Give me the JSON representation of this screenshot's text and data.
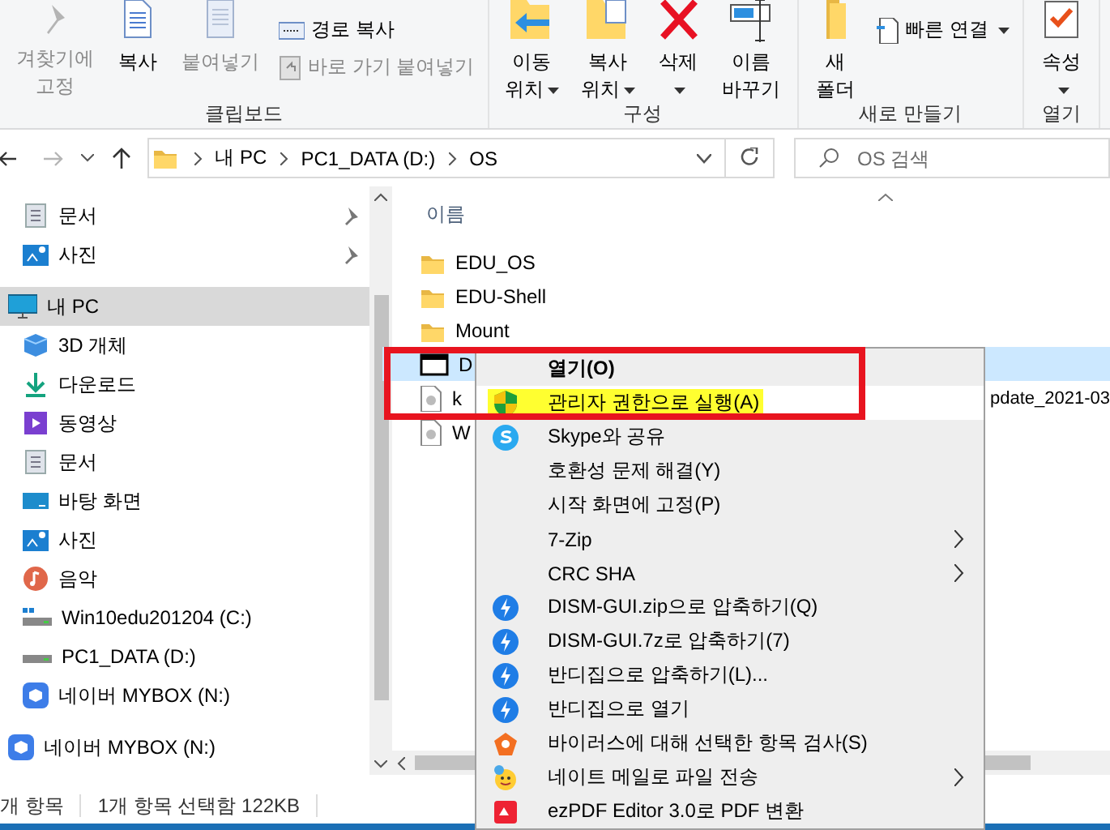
{
  "ribbon": {
    "groups": [
      {
        "label": "클립보드",
        "items": [
          {
            "kind": "large",
            "lines": [
              "겨찾기에",
              "고정"
            ],
            "dropdown": false,
            "disabled": true
          },
          {
            "kind": "large",
            "lines": [
              "복사"
            ],
            "dropdown": false,
            "disabled": false
          },
          {
            "kind": "large",
            "lines": [
              "붙여넣기"
            ],
            "dropdown": false,
            "disabled": true
          },
          {
            "kind": "small",
            "lines": [
              "경로 복사"
            ],
            "dropdown": false,
            "disabled": false
          },
          {
            "kind": "small",
            "lines": [
              "바로 가기 붙여넣기"
            ],
            "dropdown": false,
            "disabled": true
          }
        ]
      },
      {
        "label": "구성",
        "items": [
          {
            "kind": "large",
            "lines": [
              "이동",
              "위치"
            ],
            "dropdown": true,
            "disabled": false
          },
          {
            "kind": "large",
            "lines": [
              "복사",
              "위치"
            ],
            "dropdown": true,
            "disabled": false
          },
          {
            "kind": "large",
            "lines": [
              "삭제"
            ],
            "dropdown": true,
            "disabled": false
          },
          {
            "kind": "large",
            "lines": [
              "이름",
              "바꾸기"
            ],
            "dropdown": false,
            "disabled": false
          }
        ]
      },
      {
        "label": "새로 만들기",
        "items": [
          {
            "kind": "large",
            "lines": [
              "새",
              "폴더"
            ],
            "dropdown": false,
            "disabled": false
          },
          {
            "kind": "small",
            "lines": [
              "빠른 연결"
            ],
            "dropdown": true,
            "disabled": false
          }
        ]
      },
      {
        "label": "열기",
        "items": [
          {
            "kind": "large",
            "lines": [
              "속성"
            ],
            "dropdown": true,
            "disabled": false
          }
        ]
      }
    ]
  },
  "navigation": {
    "back_disabled": false,
    "forward_disabled": true
  },
  "address": {
    "path": [
      "내 PC",
      "PC1_DATA (D:)",
      "OS"
    ]
  },
  "search": {
    "placeholder": "OS 검색"
  },
  "sidebar": {
    "quick_access": [
      {
        "label": "문서",
        "pinned": true
      },
      {
        "label": "사진",
        "pinned": true
      }
    ],
    "tree": [
      {
        "label": "내 PC",
        "selected": true,
        "children": [
          {
            "label": "3D 개체",
            "selected": false
          },
          {
            "label": "다운로드",
            "selected": false
          },
          {
            "label": "동영상",
            "selected": false
          },
          {
            "label": "문서",
            "selected": false
          },
          {
            "label": "바탕 화면",
            "selected": false
          },
          {
            "label": "사진",
            "selected": false
          },
          {
            "label": "음악",
            "selected": false
          },
          {
            "label": "Win10edu201204 (C:)",
            "selected": false
          },
          {
            "label": "PC1_DATA (D:)",
            "selected": false
          },
          {
            "label": "네이버 MYBOX (N:)",
            "selected": false
          }
        ]
      },
      {
        "label": "네이버 MYBOX (N:)",
        "selected": false
      }
    ]
  },
  "file_list": {
    "columns": [
      {
        "label": "이름",
        "sorted": true
      }
    ],
    "files": [
      {
        "kind": "folder",
        "name": "EDU_OS",
        "selected": false
      },
      {
        "kind": "folder",
        "name": "EDU-Shell",
        "selected": false
      },
      {
        "kind": "folder",
        "name": "Mount",
        "selected": false
      },
      {
        "kind": "app",
        "name": "D",
        "selected": true
      },
      {
        "kind": "file",
        "name": "k",
        "name_tail": "pdate_2021-03",
        "selected": false
      },
      {
        "kind": "file",
        "name": "W",
        "selected": false
      }
    ]
  },
  "context_menu": {
    "items": [
      {
        "label": "열기(O)",
        "default": true,
        "selected": false,
        "highlighted": false,
        "submenu": false
      },
      {
        "label": "관리자 권한으로 실행(A)",
        "default": false,
        "selected": true,
        "highlighted": true,
        "submenu": false
      },
      {
        "label": "Skype와 공유",
        "default": false,
        "selected": false,
        "highlighted": false,
        "submenu": false
      },
      {
        "label": "호환성 문제 해결(Y)",
        "default": false,
        "selected": false,
        "highlighted": false,
        "submenu": false
      },
      {
        "label": "시작 화면에 고정(P)",
        "default": false,
        "selected": false,
        "highlighted": false,
        "submenu": false
      },
      {
        "label": "7-Zip",
        "default": false,
        "selected": false,
        "highlighted": false,
        "submenu": true
      },
      {
        "label": "CRC SHA",
        "default": false,
        "selected": false,
        "highlighted": false,
        "submenu": true
      },
      {
        "label": "DISM-GUI.zip으로 압축하기(Q)",
        "default": false,
        "selected": false,
        "highlighted": false,
        "submenu": false
      },
      {
        "label": "DISM-GUI.7z로 압축하기(7)",
        "default": false,
        "selected": false,
        "highlighted": false,
        "submenu": false
      },
      {
        "label": "반디집으로 압축하기(L)...",
        "default": false,
        "selected": false,
        "highlighted": false,
        "submenu": false
      },
      {
        "label": "반디집으로 열기",
        "default": false,
        "selected": false,
        "highlighted": false,
        "submenu": false
      },
      {
        "label": "바이러스에 대해 선택한 항목 검사(S)",
        "default": false,
        "selected": false,
        "highlighted": false,
        "submenu": false
      },
      {
        "label": "네이트 메일로 파일 전송",
        "default": false,
        "selected": false,
        "highlighted": false,
        "submenu": true
      },
      {
        "label": "ezPDF Editor 3.0로 PDF 변환",
        "default": false,
        "selected": false,
        "highlighted": false,
        "submenu": false
      }
    ]
  },
  "status_bar": {
    "items": [
      "개 항목",
      "1개 항목 선택함 122KB"
    ]
  }
}
